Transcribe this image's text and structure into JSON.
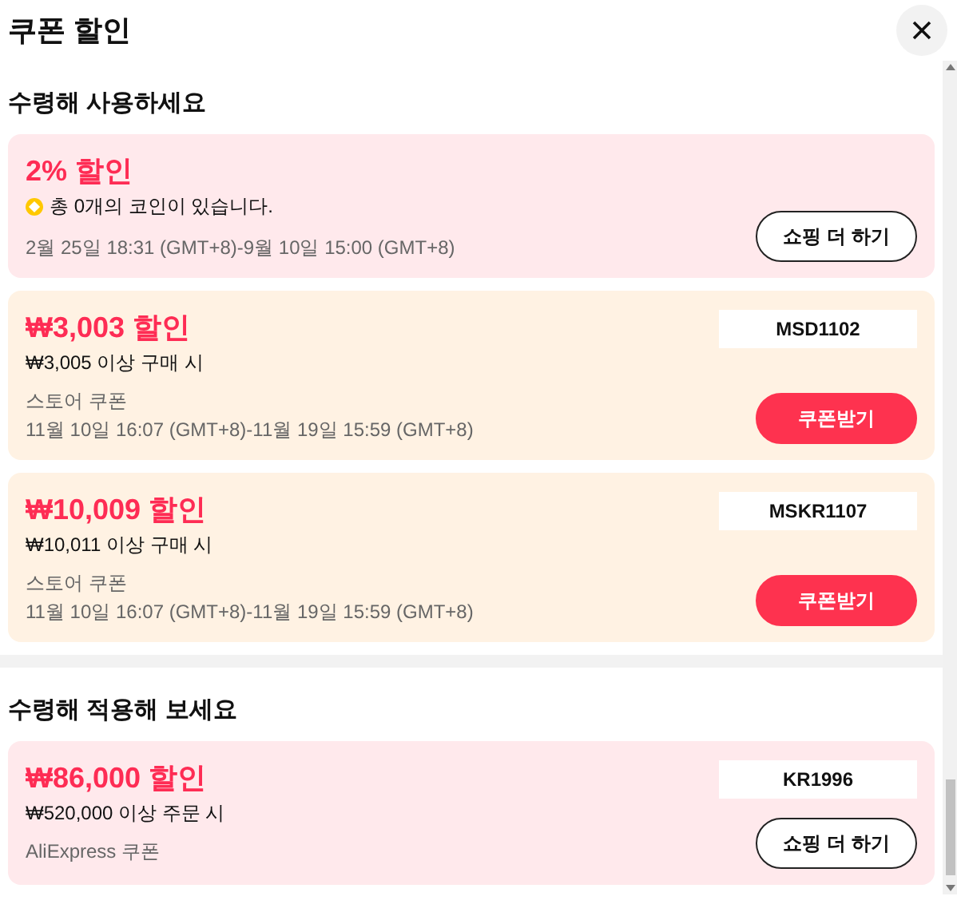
{
  "title": "쿠폰 할인",
  "sections": [
    {
      "heading": "수령해 사용하세요",
      "coupons": [
        {
          "color": "#ffe9ec",
          "title": "2% 할인",
          "note": "총 0개의 코인이 있습니다.",
          "coin": true,
          "dates": "2월 25일 18:31 (GMT+8)-9월 10일 15:00 (GMT+8)",
          "button": {
            "label": "쇼핑 더 하기",
            "kind": "outline"
          }
        },
        {
          "color": "#fff2e3",
          "title": "₩3,003 할인",
          "note": "₩3,005 이상 구매 시",
          "code": "MSD1102",
          "source": "스토어 쿠폰",
          "dates": "11월 10일 16:07 (GMT+8)-11월 19일 15:59 (GMT+8)",
          "button": {
            "label": "쿠폰받기",
            "kind": "filled"
          }
        },
        {
          "color": "#fff2e3",
          "title": "₩10,009 할인",
          "note": "₩10,011 이상 구매 시",
          "code": "MSKR1107",
          "source": "스토어 쿠폰",
          "dates": "11월 10일 16:07 (GMT+8)-11월 19일 15:59 (GMT+8)",
          "button": {
            "label": "쿠폰받기",
            "kind": "filled"
          }
        }
      ]
    },
    {
      "heading": "수령해 적용해 보세요",
      "coupons": [
        {
          "color": "#ffe9ec",
          "title": "₩86,000 할인",
          "note": "₩520,000 이상 주문 시",
          "code": "KR1996",
          "source": "AliExpress 쿠폰",
          "button": {
            "label": "쇼핑 더 하기",
            "kind": "outline"
          }
        }
      ]
    }
  ]
}
